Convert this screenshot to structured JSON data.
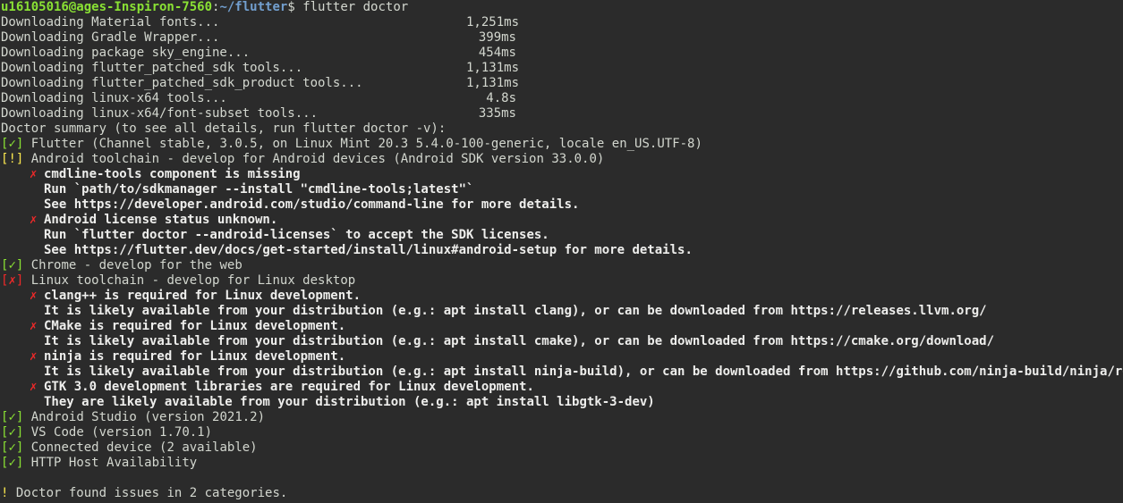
{
  "prompt": {
    "user_host": "u16105016@ages-Inspiron-7560",
    "separator": ":",
    "path": "~/flutter",
    "symbol": "$",
    "command": "flutter doctor"
  },
  "downloads": [
    {
      "label": "Downloading Material fonts...",
      "time": "1,251ms"
    },
    {
      "label": "Downloading Gradle Wrapper...",
      "time": "399ms"
    },
    {
      "label": "Downloading package sky_engine...",
      "time": "454ms"
    },
    {
      "label": "Downloading flutter_patched_sdk tools...",
      "time": "1,131ms"
    },
    {
      "label": "Downloading flutter_patched_sdk_product tools...",
      "time": "1,131ms"
    },
    {
      "label": "Downloading linux-x64 tools...",
      "time": "4.8s"
    },
    {
      "label": "Downloading linux-x64/font-subset tools...",
      "time": "335ms"
    }
  ],
  "summary_header": "Doctor summary (to see all details, run flutter doctor -v):",
  "checks": {
    "flutter": {
      "mark": "✓",
      "text": "Flutter (Channel stable, 3.0.5, on Linux Mint 20.3 5.4.0-100-generic, locale en_US.UTF-8)"
    },
    "android_toolchain": {
      "mark": "!",
      "text": "Android toolchain - develop for Android devices (Android SDK version 33.0.0)",
      "issues": [
        {
          "x": "✗",
          "title": "cmdline-tools component is missing",
          "details": [
            "Run `path/to/sdkmanager --install \"cmdline-tools;latest\"`",
            "See https://developer.android.com/studio/command-line for more details."
          ]
        },
        {
          "x": "✗",
          "title": "Android license status unknown.",
          "details": [
            "Run `flutter doctor --android-licenses` to accept the SDK licenses.",
            "See https://flutter.dev/docs/get-started/install/linux#android-setup for more details."
          ]
        }
      ]
    },
    "chrome": {
      "mark": "✓",
      "text": "Chrome - develop for the web"
    },
    "linux_toolchain": {
      "mark": "✗",
      "text": "Linux toolchain - develop for Linux desktop",
      "issues": [
        {
          "x": "✗",
          "title": "clang++ is required for Linux development.",
          "details": [
            "It is likely available from your distribution (e.g.: apt install clang), or can be downloaded from https://releases.llvm.org/"
          ]
        },
        {
          "x": "✗",
          "title": "CMake is required for Linux development.",
          "details": [
            "It is likely available from your distribution (e.g.: apt install cmake), or can be downloaded from https://cmake.org/download/"
          ]
        },
        {
          "x": "✗",
          "title": "ninja is required for Linux development.",
          "details": [
            "It is likely available from your distribution (e.g.: apt install ninja-build), or can be downloaded from https://github.com/ninja-build/ninja/releases"
          ]
        },
        {
          "x": "✗",
          "title": "GTK 3.0 development libraries are required for Linux development.",
          "details": [
            "They are likely available from your distribution (e.g.: apt install libgtk-3-dev)"
          ]
        }
      ]
    },
    "android_studio": {
      "mark": "✓",
      "text": "Android Studio (version 2021.2)"
    },
    "vscode": {
      "mark": "✓",
      "text": "VS Code (version 1.70.1)"
    },
    "connected_device": {
      "mark": "✓",
      "text": "Connected device (2 available)"
    },
    "http_host": {
      "mark": "✓",
      "text": "HTTP Host Availability"
    }
  },
  "footer": {
    "bang": "!",
    "text": "Doctor found issues in 2 categories."
  },
  "colors": {
    "background": "#2b2b2b",
    "foreground": "#d3d7cf",
    "ok": "#8ae234",
    "warn": "#fce94f",
    "error": "#ef2929",
    "path": "#729fcf"
  }
}
